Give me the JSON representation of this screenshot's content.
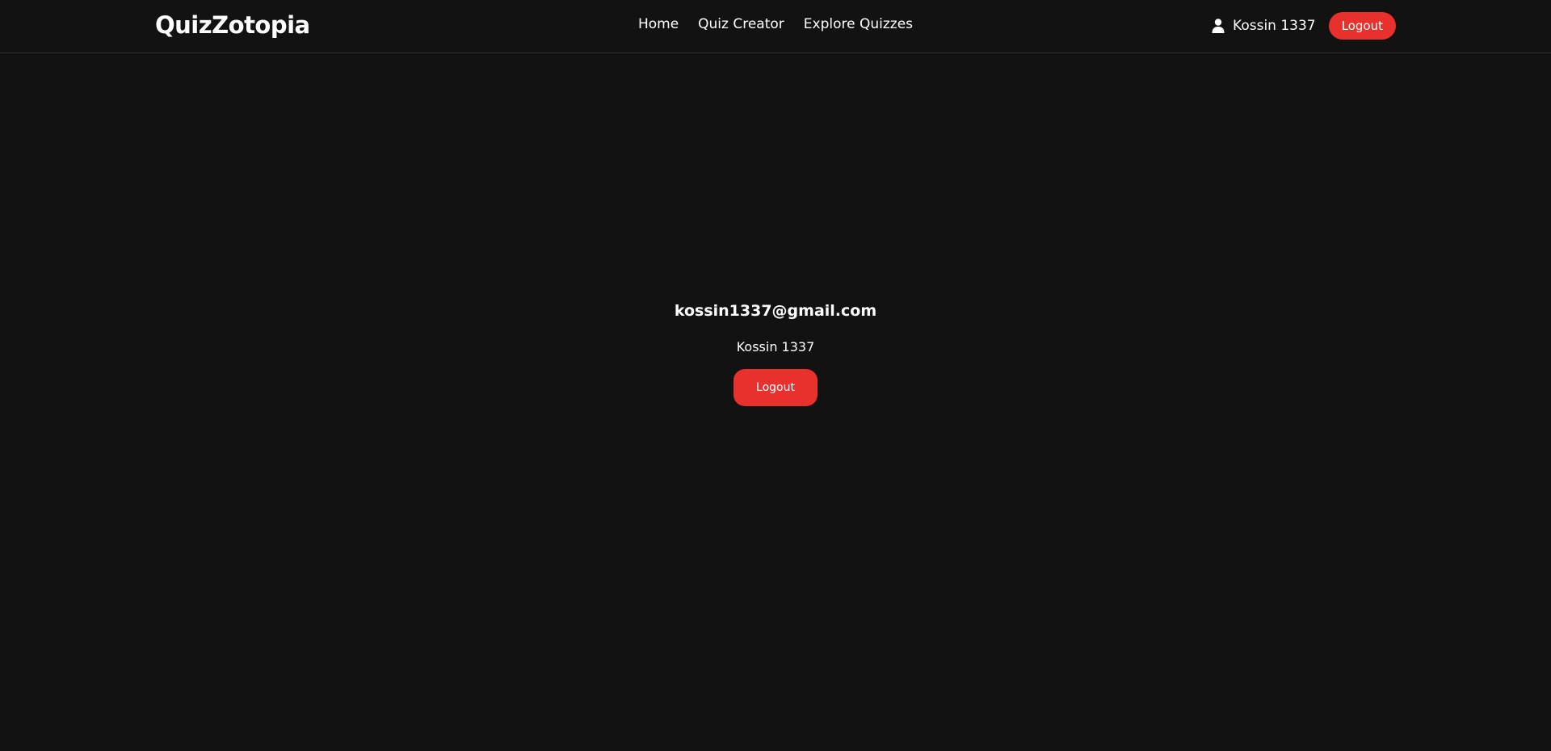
{
  "navbar": {
    "brand": "QuizZotopia",
    "links": [
      {
        "label": "Home"
      },
      {
        "label": "Quiz Creator"
      },
      {
        "label": "Explore Quizzes"
      }
    ],
    "user": {
      "icon": "user-icon",
      "name": "Kossin 1337"
    },
    "logout_label": "Logout"
  },
  "profile": {
    "email": "kossin1337@gmail.com",
    "display_name": "Kossin 1337",
    "logout_label": "Logout"
  },
  "colors": {
    "background": "#121212",
    "accent": "#e8312d",
    "text": "#ffffff",
    "divider": "#2e2e2e"
  }
}
